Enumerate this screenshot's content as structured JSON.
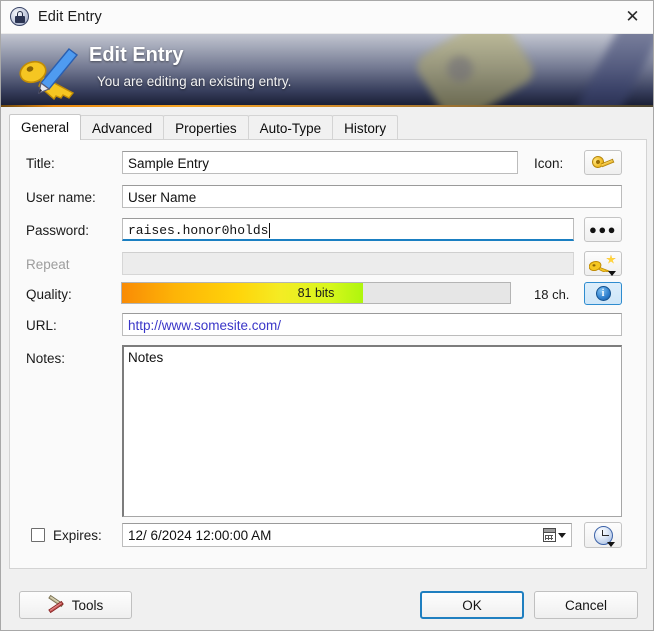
{
  "window": {
    "title": "Edit Entry",
    "icon": "lock-icon",
    "close_label": "✕"
  },
  "banner": {
    "heading": "Edit Entry",
    "subheading": "You are editing an existing entry.",
    "icon": "key-pencil-icon"
  },
  "tabs": [
    {
      "label": "General",
      "active": true
    },
    {
      "label": "Advanced",
      "active": false
    },
    {
      "label": "Properties",
      "active": false
    },
    {
      "label": "Auto-Type",
      "active": false
    },
    {
      "label": "History",
      "active": false
    }
  ],
  "form": {
    "title": {
      "label": "Title:",
      "value": "Sample Entry"
    },
    "username": {
      "label": "User name:",
      "value": "User Name"
    },
    "password": {
      "label": "Password:",
      "value": "raises.honor0holds",
      "focused": true
    },
    "repeat": {
      "label": "Repeat",
      "value": "",
      "disabled": true
    },
    "quality": {
      "label": "Quality:",
      "bits_text": "81 bits",
      "bits": 81,
      "fill_percent": 62,
      "length_text": "18 ch."
    },
    "url": {
      "label": "URL:",
      "value": "http://www.somesite.com/"
    },
    "notes": {
      "label": "Notes:",
      "value": "Notes"
    },
    "expires": {
      "label": "Expires:",
      "checked": false,
      "value": "12/  6/2024 12:00:00 AM"
    },
    "icon_picker": {
      "label": "Icon:",
      "icon": "key-icon"
    }
  },
  "buttons": {
    "toggle_password": {
      "label": "●●●",
      "icon": "three-dots-icon"
    },
    "generate_password": {
      "icon": "key-sparkle-generator-icon"
    },
    "quality_info": {
      "label": "i",
      "icon": "info-icon"
    },
    "calendar_dropdown": {
      "icon": "calendar-icon"
    },
    "expiry_presets": {
      "icon": "clock-icon"
    },
    "tools": {
      "label": "Tools",
      "icon": "tools-icon"
    },
    "ok": {
      "label": "OK",
      "focused": true
    },
    "cancel": {
      "label": "Cancel"
    }
  },
  "colors": {
    "accent": "#1f7fc0",
    "banner_rule": "#f5a323",
    "link": "#3a36c8",
    "quality_start": "#f98b05",
    "quality_end": "#aef60d"
  }
}
